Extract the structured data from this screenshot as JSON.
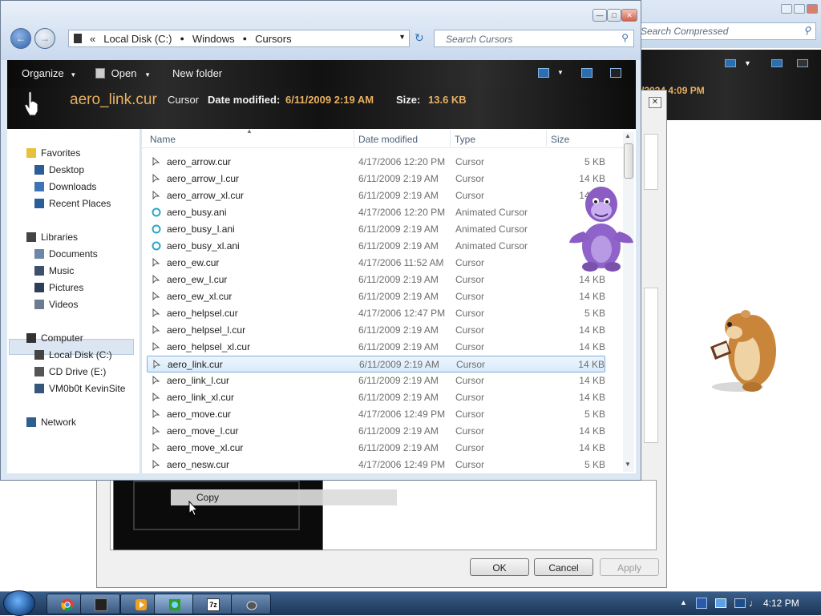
{
  "background_window": {
    "search_placeholder": "Search Compressed",
    "date_fragment": "/2024 4:09 PM"
  },
  "properties_dialog": {
    "context_item": "Copy",
    "buttons": {
      "ok": "OK",
      "cancel": "Cancel",
      "apply": "Apply"
    }
  },
  "explorer": {
    "breadcrumb_prefix": "«",
    "address": [
      "Local Disk (C:)",
      "Windows",
      "Cursors"
    ],
    "search_placeholder": "Search Cursors",
    "toolbar": {
      "organize": "Organize",
      "open": "Open",
      "new_folder": "New folder"
    },
    "details_pane": {
      "name": "aero_link.cur",
      "type": "Cursor",
      "date_label": "Date modified:",
      "date_value": "6/11/2009 2:19 AM",
      "size_label": "Size:",
      "size_value": "13.6 KB"
    },
    "nav": [
      {
        "label": "Favorites",
        "icon": "star-icon"
      },
      {
        "label": "Desktop",
        "icon": "desktop-icon"
      },
      {
        "label": "Downloads",
        "icon": "downloads-icon"
      },
      {
        "label": "Recent Places",
        "icon": "recent-places-icon"
      },
      {
        "label": "Libraries",
        "icon": "libraries-icon"
      },
      {
        "label": "Documents",
        "icon": "documents-icon"
      },
      {
        "label": "Music",
        "icon": "music-icon"
      },
      {
        "label": "Pictures",
        "icon": "pictures-icon"
      },
      {
        "label": "Videos",
        "icon": "videos-icon"
      },
      {
        "label": "Computer",
        "icon": "computer-icon"
      },
      {
        "label": "Local Disk (C:)",
        "icon": "drive-icon"
      },
      {
        "label": "CD Drive (E:)",
        "icon": "cd-drive-icon"
      },
      {
        "label": "VM0b0t KevinSite",
        "icon": "network-drive-icon"
      },
      {
        "label": "Network",
        "icon": "network-icon"
      }
    ],
    "columns": {
      "name": "Name",
      "date": "Date modified",
      "type": "Type",
      "size": "Size"
    },
    "files": [
      {
        "name": "aero_arrow.cur",
        "date": "4/17/2006 12:20 PM",
        "type": "Cursor",
        "size": "5 KB"
      },
      {
        "name": "aero_arrow_l.cur",
        "date": "6/11/2009 2:19 AM",
        "type": "Cursor",
        "size": "14 KB"
      },
      {
        "name": "aero_arrow_xl.cur",
        "date": "6/11/2009 2:19 AM",
        "type": "Cursor",
        "size": "14 KB"
      },
      {
        "name": "aero_busy.ani",
        "date": "4/17/2006 12:20 PM",
        "type": "Animated Cursor",
        "size": "3"
      },
      {
        "name": "aero_busy_l.ani",
        "date": "6/11/2009 2:19 AM",
        "type": "Animated Cursor",
        "size": ""
      },
      {
        "name": "aero_busy_xl.ani",
        "date": "6/11/2009 2:19 AM",
        "type": "Animated Cursor",
        "size": "2"
      },
      {
        "name": "aero_ew.cur",
        "date": "4/17/2006 11:52 AM",
        "type": "Cursor",
        "size": ""
      },
      {
        "name": "aero_ew_l.cur",
        "date": "6/11/2009 2:19 AM",
        "type": "Cursor",
        "size": "14 KB"
      },
      {
        "name": "aero_ew_xl.cur",
        "date": "6/11/2009 2:19 AM",
        "type": "Cursor",
        "size": "14 KB"
      },
      {
        "name": "aero_helpsel.cur",
        "date": "4/17/2006 12:47 PM",
        "type": "Cursor",
        "size": "5 KB"
      },
      {
        "name": "aero_helpsel_l.cur",
        "date": "6/11/2009 2:19 AM",
        "type": "Cursor",
        "size": "14 KB"
      },
      {
        "name": "aero_helpsel_xl.cur",
        "date": "6/11/2009 2:19 AM",
        "type": "Cursor",
        "size": "14 KB"
      },
      {
        "name": "aero_link.cur",
        "date": "6/11/2009 2:19 AM",
        "type": "Cursor",
        "size": "14 KB"
      },
      {
        "name": "aero_link_l.cur",
        "date": "6/11/2009 2:19 AM",
        "type": "Cursor",
        "size": "14 KB"
      },
      {
        "name": "aero_link_xl.cur",
        "date": "6/11/2009 2:19 AM",
        "type": "Cursor",
        "size": "14 KB"
      },
      {
        "name": "aero_move.cur",
        "date": "4/17/2006 12:49 PM",
        "type": "Cursor",
        "size": "5 KB"
      },
      {
        "name": "aero_move_l.cur",
        "date": "6/11/2009 2:19 AM",
        "type": "Cursor",
        "size": "14 KB"
      },
      {
        "name": "aero_move_xl.cur",
        "date": "6/11/2009 2:19 AM",
        "type": "Cursor",
        "size": "14 KB"
      },
      {
        "name": "aero_nesw.cur",
        "date": "4/17/2006 12:49 PM",
        "type": "Cursor",
        "size": "5 KB"
      }
    ],
    "selected_file": "aero_link.cur"
  },
  "taskbar": {
    "clock": "4:12 PM",
    "apps": [
      "chrome-icon",
      "app-window-icon",
      "media-player-icon",
      "globe-icon",
      "7zip-icon",
      "mouse-icon"
    ],
    "seven_zip_label": "7z"
  }
}
